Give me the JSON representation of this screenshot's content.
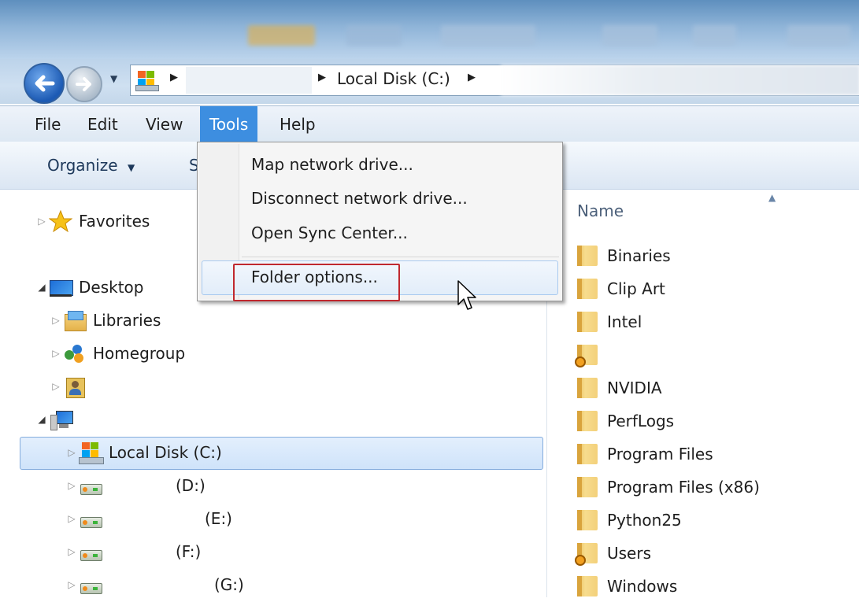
{
  "address": {
    "path": "Local Disk (C:)"
  },
  "menubar": {
    "items": [
      "File",
      "Edit",
      "View",
      "Tools",
      "Help"
    ]
  },
  "toolbar": {
    "organize": "Organize",
    "second_partial": "S"
  },
  "tools_menu": {
    "items": [
      "Map network drive...",
      "Disconnect network drive...",
      "Open Sync Center..."
    ],
    "highlighted": "Folder options..."
  },
  "nav_tree": {
    "favorites": "Favorites",
    "desktop": "Desktop",
    "libraries": "Libraries",
    "homegroup": "Homegroup",
    "local_disk": "Local Disk (C:)",
    "drives": [
      "(D:)",
      "(E:)",
      "(F:)",
      "(G:)"
    ]
  },
  "content": {
    "column_header": "Name",
    "folders": [
      "Binaries",
      "Clip Art",
      "Intel",
      "",
      "NVIDIA",
      "PerfLogs",
      "Program Files",
      "Program Files (x86)",
      "Python25",
      "Users",
      "Windows"
    ]
  },
  "colors": {
    "highlight_border": "#c0282e",
    "menu_selected": "#3d8ee0"
  }
}
